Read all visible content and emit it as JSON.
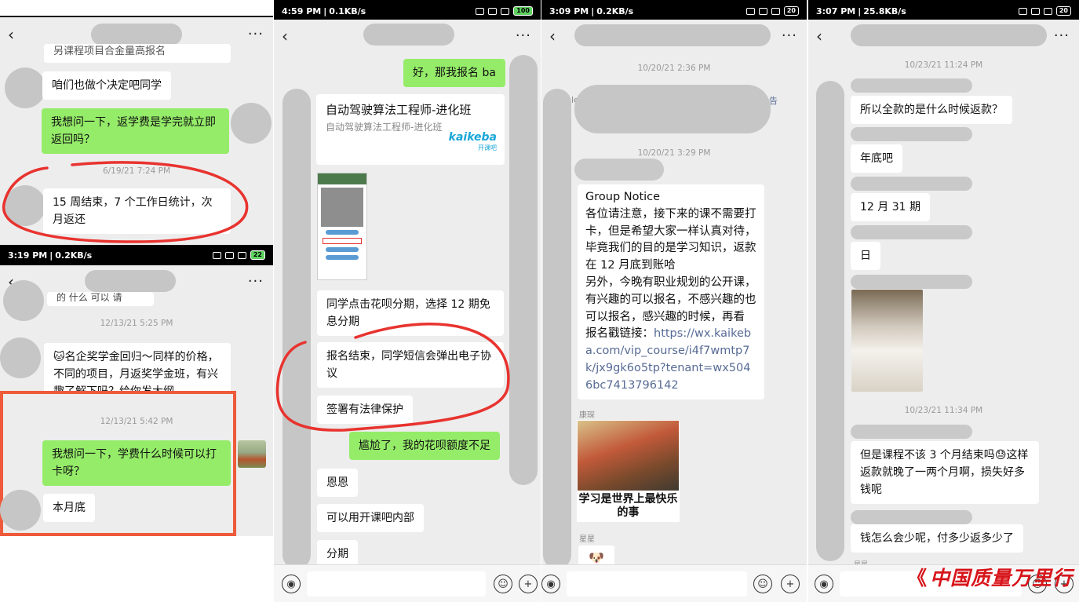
{
  "colors": {
    "chat_bg": "#ededed",
    "outgoing_bubble": "#95ec69",
    "incoming_bubble": "#ffffff",
    "annotation_red": "#e8332f",
    "link": "#576b95",
    "watermark": "#d7141a"
  },
  "common": {
    "back_icon": "‹",
    "more_icon": "···",
    "voice_icon": "◉",
    "emoji_icon": "☺",
    "plus_icon": "+"
  },
  "panel1": {
    "top": {
      "partial_message": "另课程项目合金量高报名",
      "msg_decide": "咱们也做个决定吧同学",
      "msg_ask": "我想问一下，返学费是学完就立即返回吗？",
      "timestamp": "6/19/21 7:24 PM",
      "msg_reply": "15 周结束，7 个工作日统计，次月返还"
    },
    "bottom": {
      "status": {
        "time": "3:19 PM",
        "speed": "0.2KB/s",
        "battery": "22"
      },
      "partial_message": "的  什么  可以  请",
      "timestamp1": "12/13/21 5:25 PM",
      "msg_promo_emoji": "🐱",
      "msg_promo": "名企奖学金回归～同样的价格，不同的项目，月返奖学金班，有兴趣了解下吗？给你发大纲",
      "timestamp2": "12/13/21 5:42 PM",
      "msg_ask": "我想问一下，学费什么时候可以打卡呀？",
      "msg_reply": "本月底"
    }
  },
  "panel2": {
    "status": {
      "time": "4:59 PM",
      "speed": "0.1KB/s",
      "battery": "100"
    },
    "msg_signup": "好，那我报名 ba",
    "card_title": "自动驾驶算法工程师-进化班",
    "card_subtitle": "自动驾驶算法工程师-进化班",
    "card_logo_text": "kaikeba",
    "card_logo_sub": "开课吧",
    "msg_huabei": "同学点击花呗分期，选择 12 期免息分期",
    "msg_sms": "报名结束，同学短信会弹出电子协议",
    "msg_legal": "签署有法律保护",
    "msg_embarrassed": "尴尬了，我的花呗额度不足",
    "msg_enen": "恩恩",
    "msg_internal": "可以用开课吧内部",
    "msg_fenqi": "分期"
  },
  "panel3": {
    "status": {
      "time": "3:09 PM",
      "speed": "0.2KB/s",
      "battery": "20"
    },
    "timestamp1": "10/20/21 2:36 PM",
    "timestamp2": "10/20/21 3:29 PM",
    "edge_left": "le",
    "edge_right": "告",
    "notice_title": "Group Notice",
    "notice_body": "各位请注意，接下来的课不需要打卡，但是希望大家一样认真对待，毕竟我们的目的是学习知识，返款在 12 月底到账哈\n另外，今晚有职业规划的公开课，有兴趣的可以报名，不感兴趣的也可以报名，感兴趣的时候，再看\n报名戳链接：",
    "notice_link": "https://wx.kaikeba.com/vip_course/i4f7wmtp7k/jx9gk6o5tp?tenant=wx5046bc7413796142",
    "sender1": "康琛",
    "meme_caption": "学习是世界上最快乐的事",
    "sender2": "星星"
  },
  "panel4": {
    "status": {
      "time": "3:07 PM",
      "speed": "25.8KB/s",
      "battery": "20"
    },
    "timestamp1": "10/23/21 11:24 PM",
    "msg_when_refund": "所以全款的是什么时候返款？",
    "msg_year_end": "年底吧",
    "msg_dec31": "12 月 31 期",
    "msg_ri": "日",
    "timestamp2": "10/23/21 11:34 PM",
    "msg_complain_a": "但是课程不该 3 个月结束吗",
    "msg_complain_emoji": "😓",
    "msg_complain_b": "这样返款就晚了一两个月啊，损失好多钱呢",
    "msg_how_less": "钱怎么会少呢，付多少返多少了",
    "partial_name": "星星"
  },
  "watermark": {
    "mark": "《",
    "text": "中国质量万里行"
  }
}
